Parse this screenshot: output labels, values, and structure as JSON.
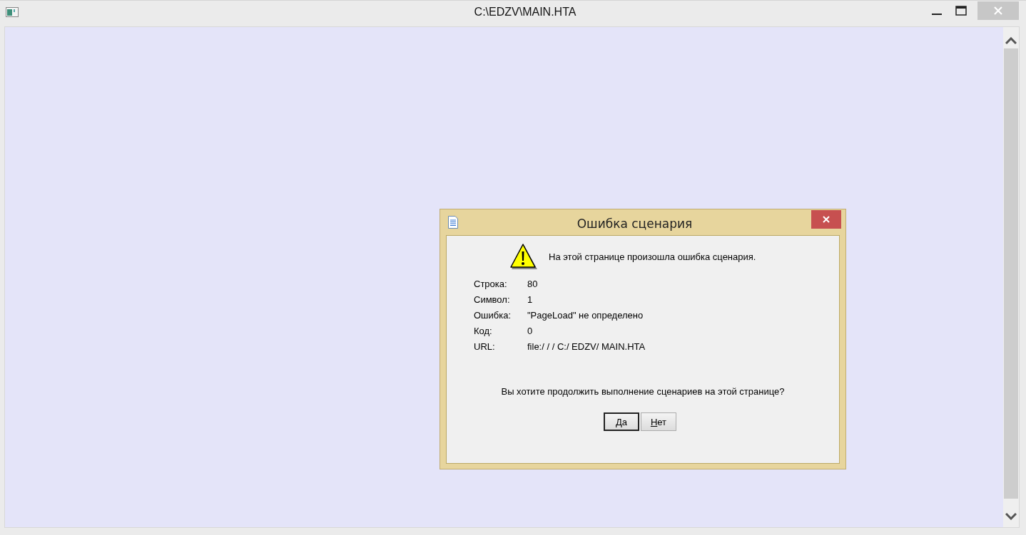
{
  "window": {
    "title": "C:\\EDZV\\MAIN.HTA"
  },
  "dialog": {
    "title": "Ошибка сценария",
    "message": "На этой странице произошла ошибка сценария.",
    "details": [
      {
        "label": "Строка:",
        "value": "80"
      },
      {
        "label": "Символ:",
        "value": "1"
      },
      {
        "label": "Ошибка:",
        "value": "\"PageLoad\" не определено"
      },
      {
        "label": "Код:",
        "value": "0"
      },
      {
        "label": "URL:",
        "value": "file:/ / / C:/ EDZV/ MAIN.HTA"
      }
    ],
    "question": "Вы хотите продолжить выполнение сценариев на этой странице?",
    "buttons": [
      {
        "mnemonic": "Д",
        "label_rest": "а",
        "default": true
      },
      {
        "mnemonic": "Н",
        "label_rest": "ет",
        "default": false
      }
    ]
  }
}
